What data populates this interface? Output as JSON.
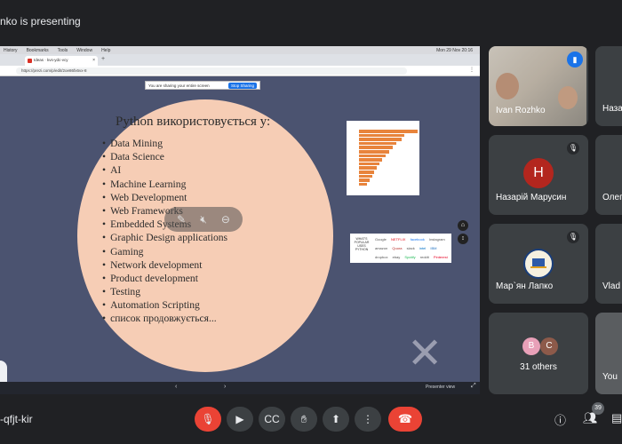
{
  "header": {
    "presenting_text": "nko is presenting"
  },
  "browser": {
    "mac_menu": [
      "History",
      "Bookmarks",
      "Tools",
      "Window",
      "Help"
    ],
    "mac_clock": "Mon 29 Nov 20:16",
    "tab_title": "Ideas · kvs-ydc-vcy",
    "new_tab": "+",
    "address": "https://prezi.com/p/edit/2oe86fx6vx-8",
    "share_banner": {
      "text": "You are sharing your entire screen",
      "stop_label": "Stop Sharing"
    }
  },
  "slide": {
    "title": "Python використовується у:",
    "items": [
      "Data Mining",
      "Data Science",
      "AI",
      "Machine Learning",
      "Web Development",
      "Web Frameworks",
      "Embedded Systems",
      "Graphic Design applications",
      "Gaming",
      "Network development",
      "Product development",
      "Testing",
      "Automation Scripting",
      "список продовжується..."
    ],
    "thumb_logos": {
      "python_caption": "WHAT'S POPULAR USES PYTHON",
      "row1": [
        "Google",
        "NETFLIX",
        "facebook",
        "Instagram"
      ],
      "row2": [
        "amazon",
        "Quora",
        "slack",
        "intel",
        "IBM"
      ],
      "row3": [
        "dropbox",
        "ebay",
        "Spotify",
        "reddit",
        "Pinterest"
      ]
    }
  },
  "prezi_bar": {
    "presenter_view": "Presenter view"
  },
  "participants": [
    {
      "name": "Ivan Rozhko",
      "speaking": true
    },
    {
      "name": "Наза",
      "partial": true
    },
    {
      "name": "Назарій Марусин",
      "initial": "Н",
      "color": "#b3261e",
      "muted": true
    },
    {
      "name": "Олег",
      "partial": true
    },
    {
      "name": "Мар`ян Лапко",
      "muted": true
    },
    {
      "name": "Vlad",
      "partial": true
    },
    {
      "name": "You",
      "partial": true
    }
  ],
  "others": {
    "label": "31 others",
    "initials": [
      "B",
      "C"
    ]
  },
  "footer": {
    "meeting_code": "-qfjt-kir",
    "participant_count": "39"
  },
  "colors": {
    "hangup": "#ea4335",
    "accent": "#1a73e8",
    "slide_bg": "#4b5370",
    "circle": "#f6cdb5"
  }
}
